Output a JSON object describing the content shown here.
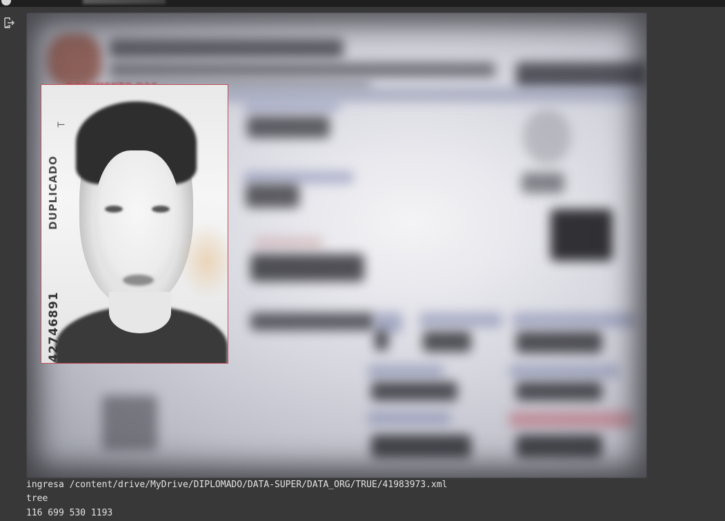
{
  "output": {
    "lines": [
      "ingresa /content/drive/MyDrive/DIPLOMADO/DATA-SUPER/DATA_ORG/TRUE/41983973.xml",
      "tree",
      "116 699 530 1193"
    ]
  },
  "id_card": {
    "photo_vertical_text": "DUPLICADO",
    "photo_number": "42746891",
    "photo_letter": "T",
    "header_fragment": "DOCUMENTO NAC"
  },
  "colors": {
    "background": "#383838",
    "bbox_outline": "#c04a55",
    "stdout_text": "#e4e4e4"
  },
  "icons": {
    "output_icon": "output-exit-icon"
  }
}
